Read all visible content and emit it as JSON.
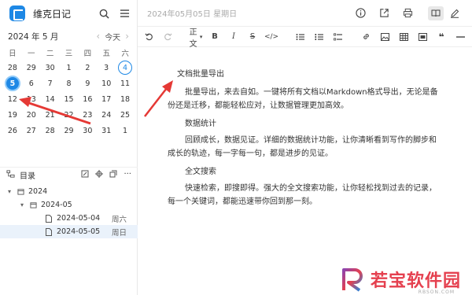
{
  "app": {
    "title": "维克日记"
  },
  "calendar": {
    "month_label": "2024 年 5 月",
    "today_label": "今天",
    "weekdays": [
      "日",
      "一",
      "二",
      "三",
      "四",
      "五",
      "六"
    ],
    "weeks": [
      [
        "28",
        "29",
        "30",
        "1",
        "2",
        "3",
        "4"
      ],
      [
        "5",
        "6",
        "7",
        "8",
        "9",
        "10",
        "11"
      ],
      [
        "12",
        "13",
        "14",
        "15",
        "16",
        "17",
        "18"
      ],
      [
        "19",
        "20",
        "21",
        "22",
        "23",
        "24",
        "25"
      ],
      [
        "26",
        "27",
        "28",
        "29",
        "30",
        "31",
        "1"
      ]
    ],
    "selected": "5",
    "today": "4"
  },
  "tree": {
    "header_label": "目录",
    "year": "2024",
    "month": "2024-05",
    "docs": [
      {
        "date": "2024-05-04",
        "weekday": "周六"
      },
      {
        "date": "2024-05-05",
        "weekday": "周日"
      }
    ]
  },
  "editor": {
    "doc_title": "2024年05月05日 星期日",
    "style_label": "正文",
    "sections": [
      {
        "heading": "文档批量导出",
        "body": "批量导出，来去自如。一键将所有文档以Markdown格式导出，无论是备份还是迁移，都能轻松应对，让数据管理更加高效。"
      },
      {
        "heading": "数据统计",
        "body": "回顾成长，数据见证。详细的数据统计功能，让你清晰看到写作的脚步和成长的轨迹，每一字每一句，都是进步的见证。"
      },
      {
        "heading": "全文搜索",
        "body": "快速检索，即搜即得。强大的全文搜索功能，让你轻松找到过去的记录，每一个关键词，都能迅速带你回到那一刻。"
      }
    ]
  },
  "watermark": {
    "text": "若宝软件园",
    "url": "RBSON.COM"
  },
  "colors": {
    "accent": "#1e88e5",
    "arrow": "#e53935",
    "brand": "#e5404f"
  }
}
